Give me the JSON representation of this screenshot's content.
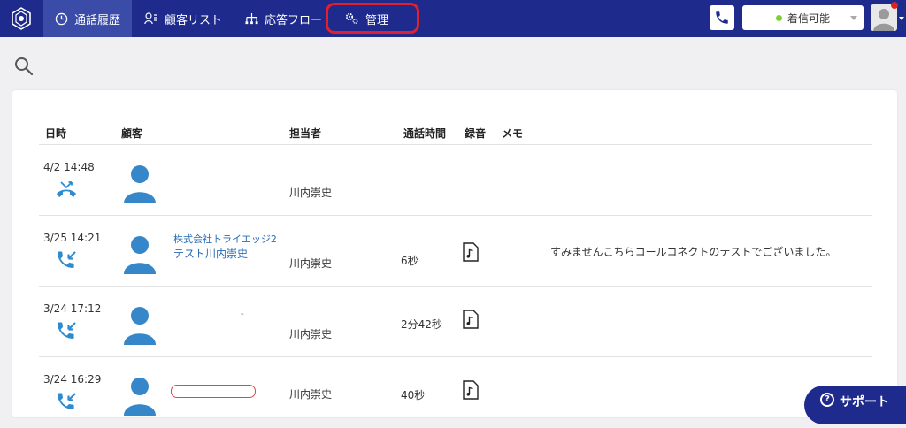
{
  "nav": {
    "items": [
      {
        "label": "通話履歴",
        "icon": "clock-icon",
        "active": true
      },
      {
        "label": "顧客リスト",
        "icon": "customer-list-icon",
        "active": false
      },
      {
        "label": "応答フロー",
        "icon": "flow-icon",
        "active": false
      },
      {
        "label": "管理",
        "icon": "gear-icon",
        "active": false
      }
    ],
    "status": "着信可能",
    "status_color": "#7cd032",
    "highlight_color": "#e0202c",
    "bar_color": "#1e2a8c"
  },
  "table": {
    "headers": {
      "datetime": "日時",
      "customer": "顧客",
      "agent": "担当者",
      "duration": "通話時間",
      "recording": "録音",
      "memo": "メモ"
    },
    "rows": [
      {
        "datetime": "4/2 14:48",
        "call_type": "missed-call-icon",
        "company": "",
        "customer": "",
        "agent": "川内崇史",
        "duration": "",
        "has_recording": false,
        "memo": ""
      },
      {
        "datetime": "3/25 14:21",
        "call_type": "incoming-call-icon",
        "company": "株式会社トライエッジ2",
        "customer": "テスト川内崇史",
        "agent": "川内崇史",
        "duration": "6秒",
        "has_recording": true,
        "memo": "すみませんこちらコールコネクトのテストでございました。"
      },
      {
        "datetime": "3/24 17:12",
        "call_type": "incoming-call-icon",
        "company": "",
        "customer": "-",
        "agent": "川内崇史",
        "duration": "2分42秒",
        "has_recording": true,
        "memo": ""
      },
      {
        "datetime": "3/24 16:29",
        "call_type": "incoming-call-icon",
        "company": "",
        "customer": "",
        "agent": "川内崇史",
        "duration": "40秒",
        "has_recording": true,
        "memo": ""
      }
    ]
  },
  "support": {
    "label": "サポート"
  }
}
